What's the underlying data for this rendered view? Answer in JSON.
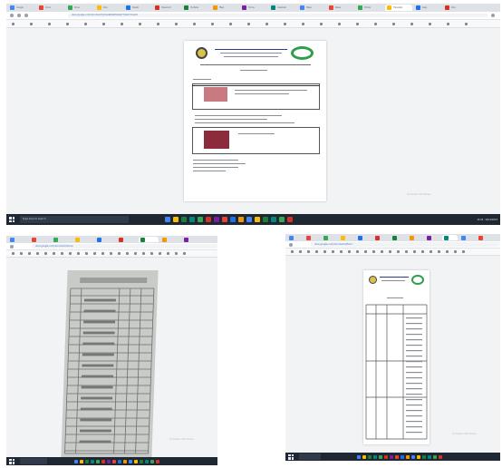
{
  "screenshots": {
    "top": {
      "tabs": [
        "Google",
        "Inbox",
        "Drive",
        "Docs",
        "Sheets",
        "Classroom",
        "YouTube",
        "Meet",
        "Forms",
        "Calendar",
        "Maps",
        "News",
        "Photos",
        "Translate",
        "Keep",
        "Docs"
      ],
      "url": "docs.google.com/document/d/1xA9kQzP3vRwT7mLbY2c/edit",
      "search_placeholder": "Type here to search",
      "clock": "12:45",
      "date": "10/11/2023",
      "watermark": "Activate Windows"
    },
    "bottom_left": {
      "url": "docs.google.com/document/d/scan",
      "watermark": "Activate Windows"
    },
    "bottom_right": {
      "url": "docs.google.com/document/d/form",
      "watermark": "Activate Windows"
    }
  },
  "colors": {
    "tabbar": "#dee1e6",
    "taskbar": "#1f2733",
    "accent_blue": "#1a73e8",
    "logo_green": "#2e9e4a"
  }
}
